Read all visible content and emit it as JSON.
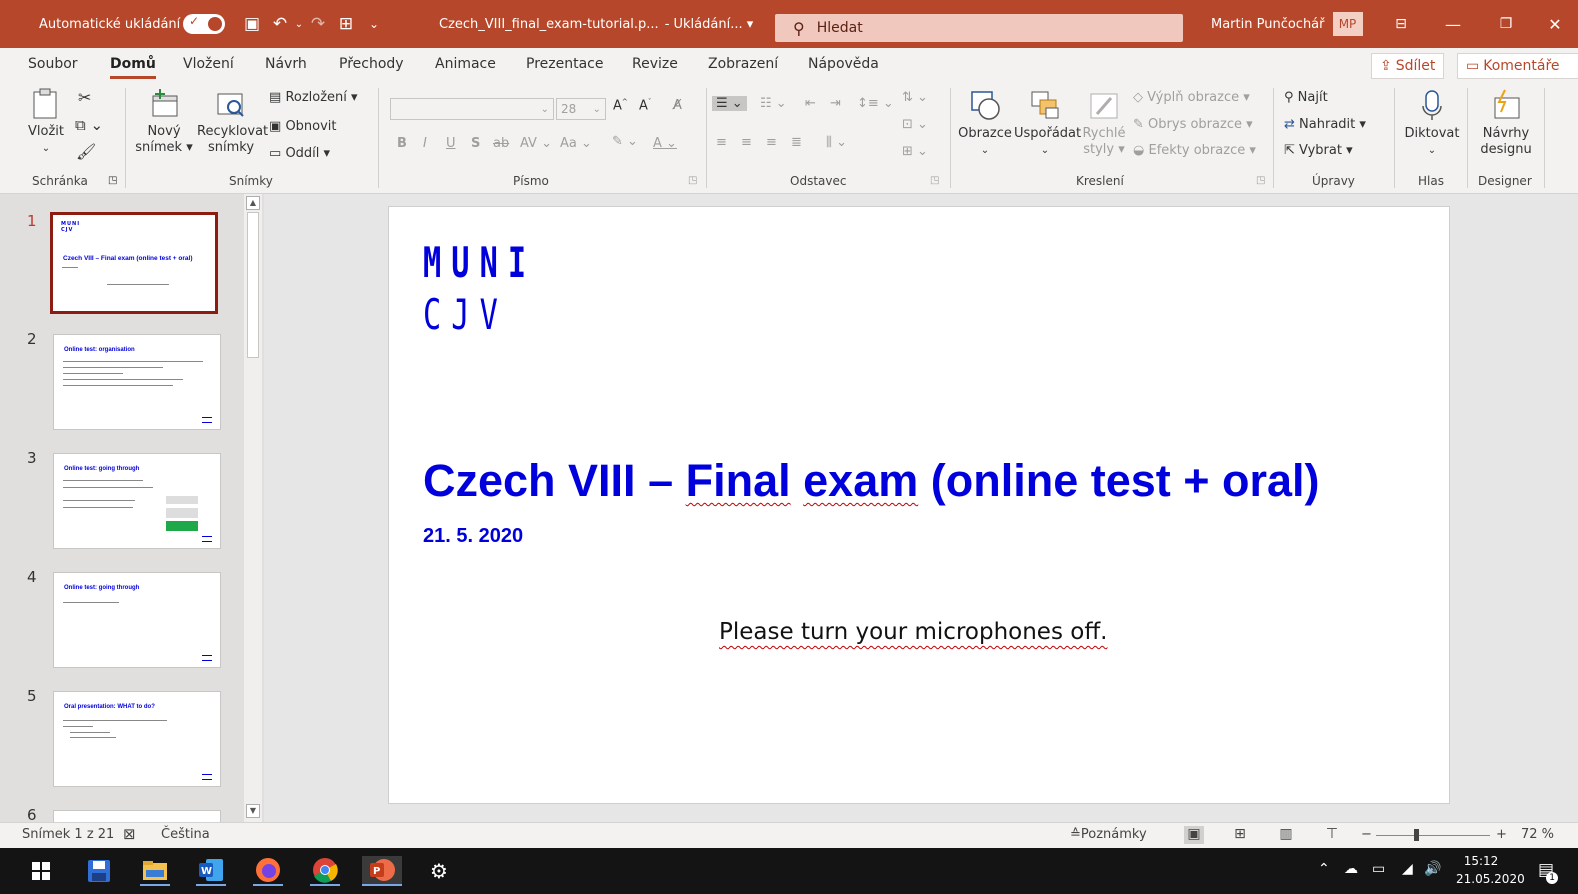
{
  "titlebar": {
    "autosave_label": "Automatické ukládání",
    "toggle_state": "on",
    "filename": "Czech_VIII_final_exam-tutorial.p...",
    "saving_status": "- Ukládání... ▾",
    "search_placeholder": "Hledat",
    "user_name": "Martin Punčochář",
    "user_initials": "MP"
  },
  "tabs": [
    "Soubor",
    "Domů",
    "Vložení",
    "Návrh",
    "Přechody",
    "Animace",
    "Prezentace",
    "Revize",
    "Zobrazení",
    "Nápověda"
  ],
  "active_tab": "Domů",
  "share_label": "Sdílet",
  "comments_label": "Komentáře",
  "ribbon": {
    "clipboard": {
      "paste": "Vložit",
      "group": "Schránka"
    },
    "slides": {
      "new_slide_1": "Nový",
      "new_slide_2": "snímek ▾",
      "reuse_1": "Recyklovat",
      "reuse_2": "snímky",
      "layout": "Rozložení ▾",
      "reset": "Obnovit",
      "section": "Oddíl ▾",
      "group": "Snímky"
    },
    "font": {
      "size": "28",
      "bold": "B",
      "italic": "I",
      "underline": "U",
      "shadow": "S",
      "strike": "ab",
      "spacing": "AV",
      "case": "Aa",
      "group": "Písmo"
    },
    "paragraph": {
      "group": "Odstavec"
    },
    "drawing": {
      "shapes": "Obrazce",
      "arrange": "Uspořádat",
      "quick_1": "Rychlé",
      "quick_2": "styly ▾",
      "fill": "Výplň obrazce ▾",
      "outline": "Obrys obrazce ▾",
      "effects": "Efekty obrazce ▾",
      "group": "Kreslení"
    },
    "editing": {
      "find": "Najít",
      "replace": "Nahradit ▾",
      "select": "Vybrat ▾",
      "group": "Úpravy"
    },
    "voice": {
      "dictate": "Diktovat",
      "group": "Hlas"
    },
    "designer": {
      "ideas_1": "Návrhy",
      "ideas_2": "designu",
      "group": "Designer"
    }
  },
  "thumbnails": [
    {
      "number": "1",
      "title": "Czech VIII – Final exam (online test + oral)"
    },
    {
      "number": "2",
      "title": "Online test: organisation"
    },
    {
      "number": "3",
      "title": "Online test: going through"
    },
    {
      "number": "4",
      "title": "Online test: going through"
    },
    {
      "number": "5",
      "title": "Oral presentation: WHAT to do?"
    },
    {
      "number": "6",
      "title": ""
    }
  ],
  "slide": {
    "logo_line1": "MUNI",
    "logo_line2": "CJV",
    "title_a": "Czech VIII – ",
    "title_b": "Final",
    "title_c": " ",
    "title_d": "exam",
    "title_e": " (online test + oral)",
    "date": "21. 5. 2020",
    "subtitle": "Please turn your microphones off."
  },
  "statusbar": {
    "slide_info": "Snímek 1 z 21",
    "language": "Čeština",
    "notes": "Poznámky",
    "zoom": "72 %"
  },
  "taskbar": {
    "time": "15:12",
    "date": "21.05.2020",
    "notification_count": "1"
  }
}
